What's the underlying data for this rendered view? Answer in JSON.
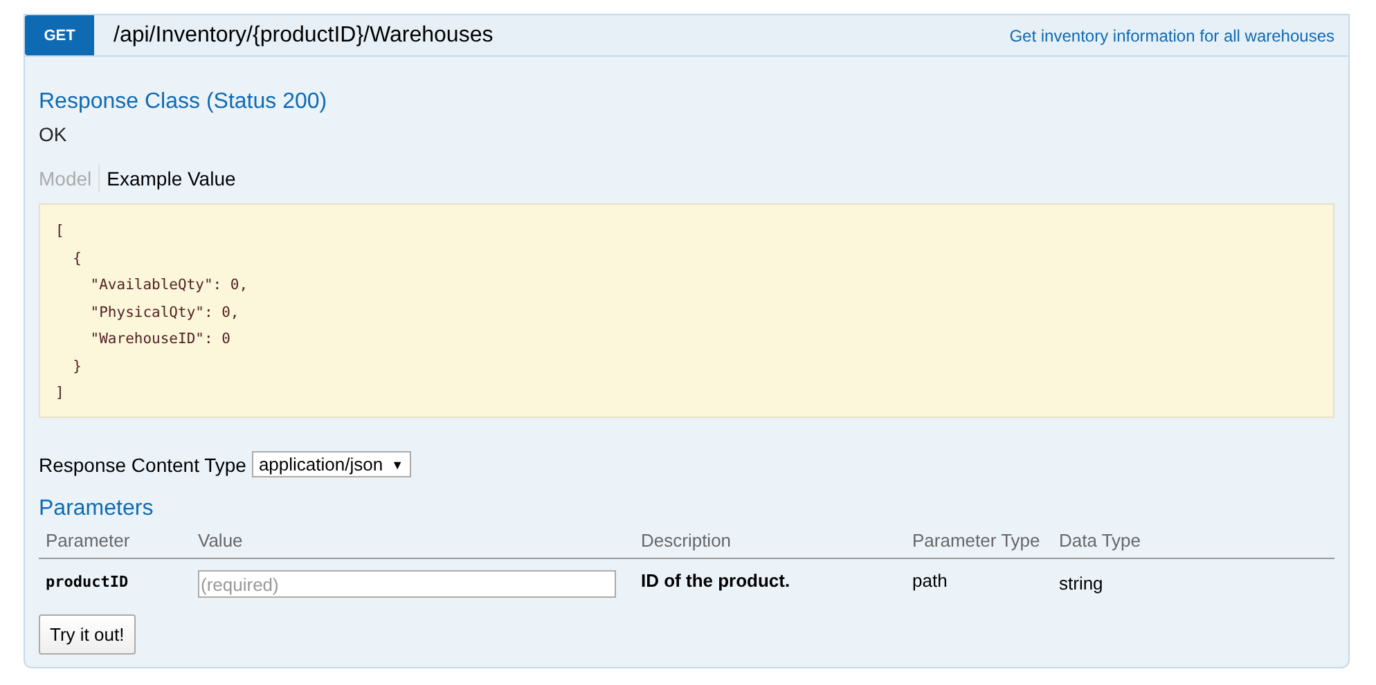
{
  "operation": {
    "method": "GET",
    "path": "/api/Inventory/{productID}/Warehouses",
    "summary": "Get inventory information for all warehouses"
  },
  "response_class": {
    "title": "Response Class (Status 200)",
    "status_text": "OK"
  },
  "tabs": [
    {
      "label": "Model",
      "selected": false
    },
    {
      "label": "Example Value",
      "selected": true
    }
  ],
  "example_value": "[\n  {\n    \"AvailableQty\": 0,\n    \"PhysicalQty\": 0,\n    \"WarehouseID\": 0\n  }\n]",
  "response_content_type": {
    "label": "Response Content Type",
    "value": "application/json",
    "caret": "▼"
  },
  "parameters": {
    "title": "Parameters",
    "columns": [
      "Parameter",
      "Value",
      "Description",
      "Parameter Type",
      "Data Type"
    ],
    "rows": [
      {
        "name": "productID",
        "placeholder": "(required)",
        "description": "ID of the product.",
        "parameter_type": "path",
        "data_type": "string"
      }
    ]
  },
  "button": "Try it out!"
}
